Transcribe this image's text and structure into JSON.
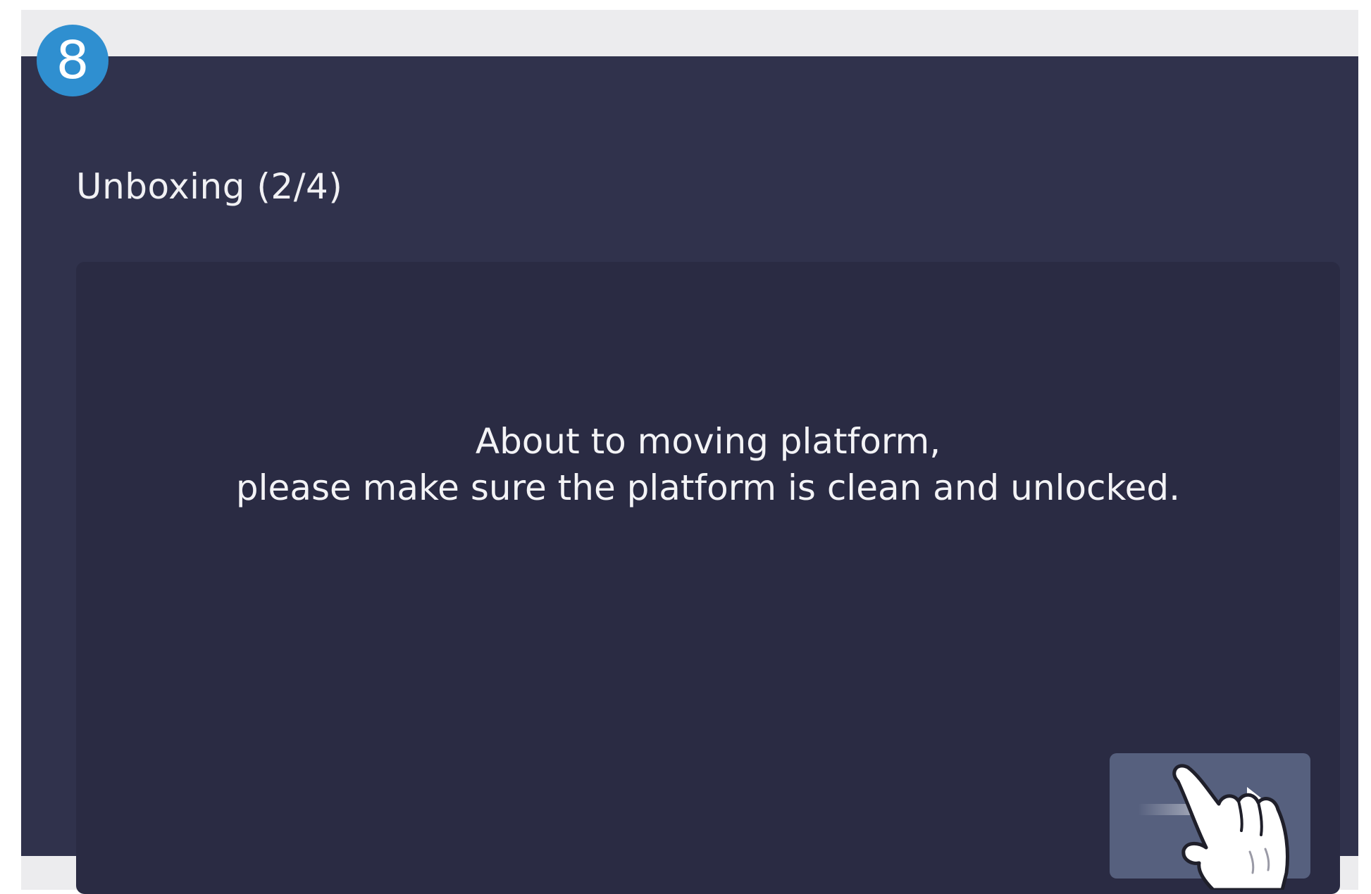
{
  "step": {
    "number": "8"
  },
  "screen": {
    "title": "Unboxing (2/4)"
  },
  "message": {
    "line1": "About to moving platform,",
    "line2": "please make sure the platform is clean and unlocked."
  },
  "next_button": {
    "icon": "arrow-right-icon"
  },
  "pointer": {
    "icon": "hand-pointer-icon"
  },
  "colors": {
    "screen_bg": "#30324c",
    "panel_bg": "#2a2b43",
    "badge": "#2f8fd0",
    "button": "#56607e"
  }
}
